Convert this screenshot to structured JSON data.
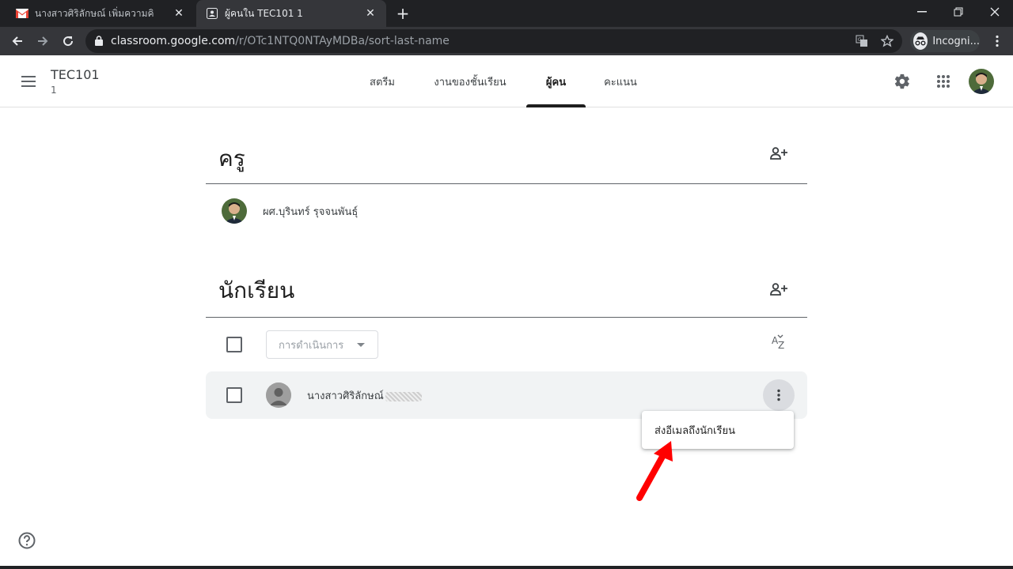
{
  "browser": {
    "tabs": [
      {
        "title": "นางสาวศิริลักษณ์ เพิ่มความคิ",
        "icon": "gmail-icon",
        "active": false
      },
      {
        "title": "ผู้คนใน TEC101 1",
        "icon": "classroom-people-icon",
        "active": true
      }
    ],
    "url_host": "classroom.google.com",
    "url_path": "/r/OTc1NTQ0NTAyMDBa/sort-last-name",
    "incognito_label": "Incogni..."
  },
  "app": {
    "class_name": "TEC101",
    "section": "1",
    "nav_tabs": [
      "สตรีม",
      "งานของชั้นเรียน",
      "ผู้คน",
      "คะแนน"
    ],
    "active_tab": "ผู้คน"
  },
  "teachers": {
    "heading": "ครู",
    "items": [
      {
        "name": "ผศ.บุรินทร์ รุจจนพันธุ์"
      }
    ]
  },
  "students": {
    "heading": "นักเรียน",
    "actions_label": "การดำเนินการ",
    "items": [
      {
        "name": "นางสาวศิริลักษณ์"
      }
    ]
  },
  "menu": {
    "email_student": "ส่งอีเมลถึงนักเรียน"
  },
  "colors": {
    "tab_bar": "#202124",
    "toolbar": "#35363a",
    "annotation_arrow": "#ff0000",
    "row_highlight": "#f1f3f4"
  }
}
